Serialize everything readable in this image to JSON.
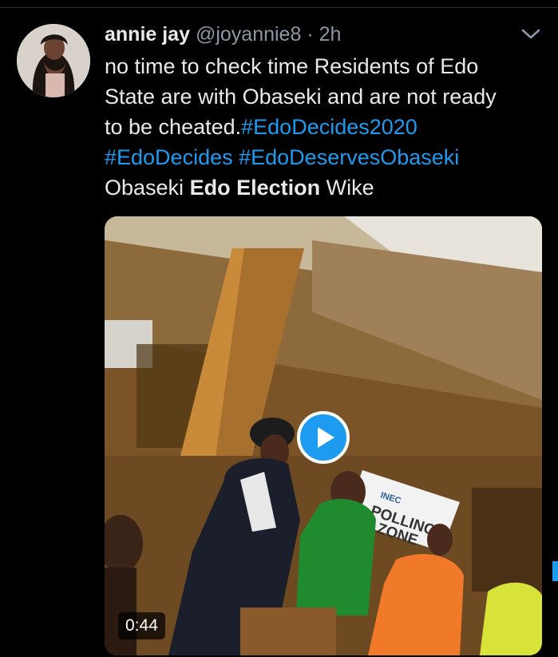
{
  "tweet": {
    "display_name": "annie jay",
    "handle": "@joyannie8",
    "separator": "·",
    "time": "2h",
    "text_lines": [
      "no time to check time Residents of Edo",
      "State are with Obaseki and are not ready",
      "to be cheated."
    ],
    "hashtags": [
      "#EdoDecides2020",
      "#EdoDecides",
      "#EdoDeservesObaseki"
    ],
    "topics": {
      "plain_1": "Obaseki",
      "bold": "Edo Election",
      "plain_2": "Wike"
    }
  },
  "media": {
    "type": "video",
    "duration": "0:44",
    "sign_lines": [
      "INEC",
      "POLLING",
      "ZONE"
    ]
  },
  "colors": {
    "background": "#000000",
    "text": "#e7e9ea",
    "muted": "#8b98a5",
    "link": "#1d9bf0"
  },
  "icons": {
    "menu": "chevron-down-icon",
    "play": "play-icon"
  }
}
